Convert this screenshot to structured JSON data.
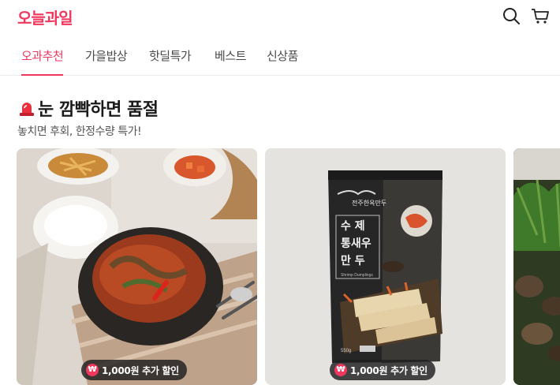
{
  "header": {
    "logo": "오늘과일",
    "search_icon": "search-icon",
    "cart_icon": "cart-icon"
  },
  "tabs": [
    {
      "label": "오과추천",
      "active": true
    },
    {
      "label": "가을밥상",
      "active": false
    },
    {
      "label": "핫딜특가",
      "active": false
    },
    {
      "label": "베스트",
      "active": false
    },
    {
      "label": "신상품",
      "active": false
    }
  ],
  "section": {
    "icon": "siren-icon",
    "title": "눈 깜빡하면 품절",
    "subtitle": "놓치면 후회, 한정수량 특가!"
  },
  "products": [
    {
      "image": "soup-food-image",
      "badge": "1,000원 추가 할인"
    },
    {
      "image": "shrimp-dumpling-package-image",
      "badge": "1,000원 추가 할인",
      "package": {
        "brand": "전주한옥만두",
        "name_line1": "수  제",
        "name_line2": "통새우",
        "name_line3": "만  두",
        "english": "Shrimp Dumplings",
        "weight": "550g"
      }
    },
    {
      "image": "vegetable-mushroom-image"
    }
  ],
  "colors": {
    "accent": "#f0375d"
  }
}
